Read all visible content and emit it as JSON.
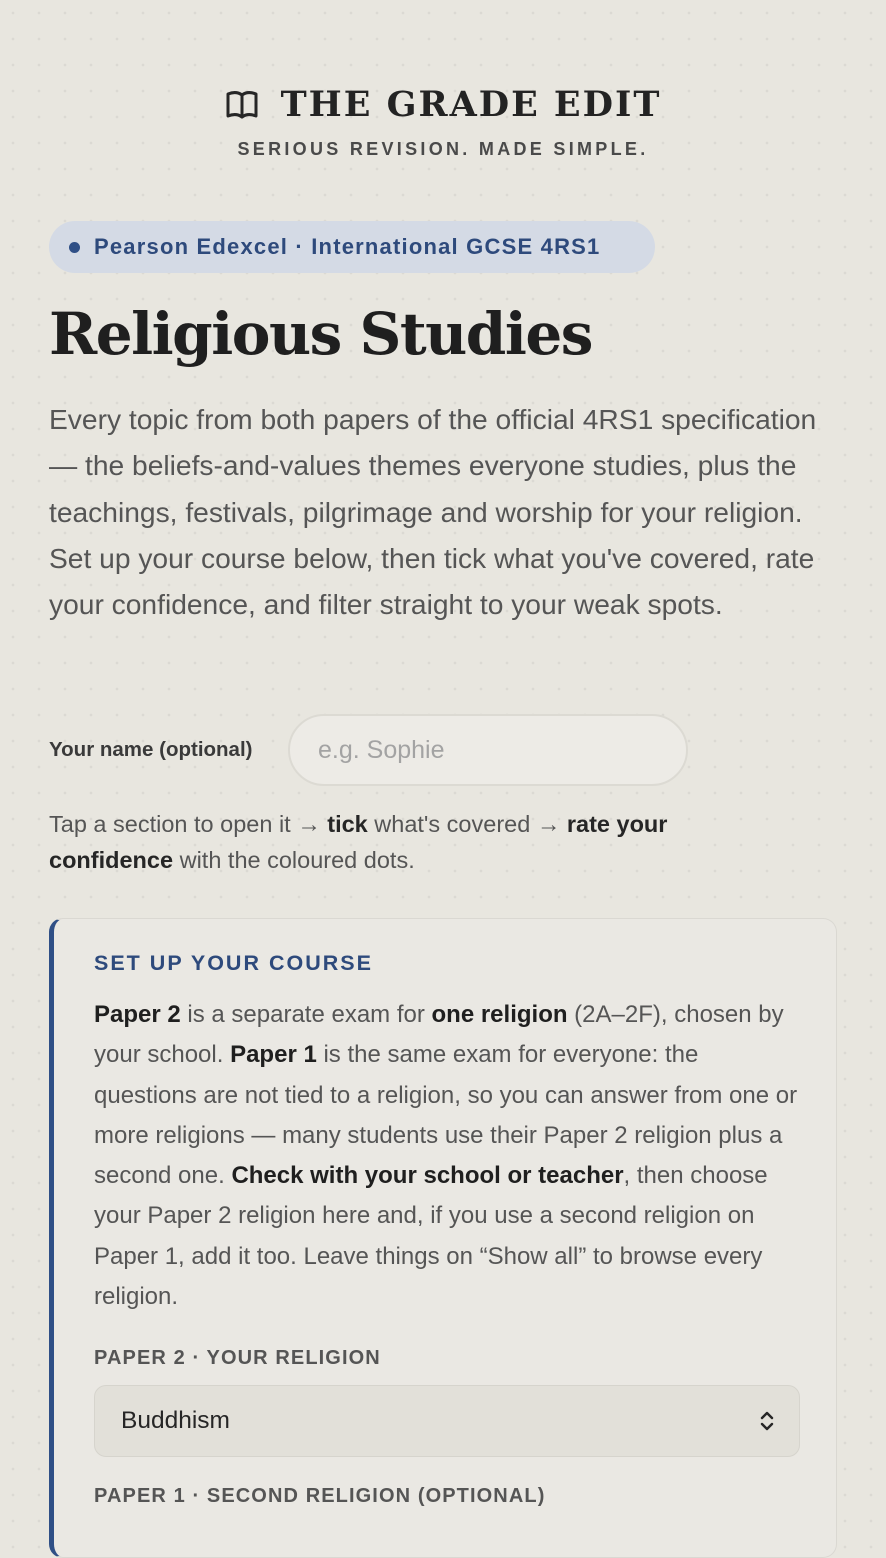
{
  "brand": {
    "title": "THE GRADE EDIT",
    "tagline": "SERIOUS REVISION. MADE SIMPLE.",
    "icon": "open-book-icon"
  },
  "badge": {
    "text": "Pearson Edexcel · International GCSE 4RS1",
    "accent": "#2f4f86"
  },
  "page": {
    "title": "Religious Studies",
    "intro": "Every topic from both papers of the official 4RS1 specification — the beliefs-and-values themes everyone studies, plus the teachings, festivals, pilgrimage and worship for your religion. Set up your course below, then tick what you've covered, rate your confidence, and filter straight to your weak spots."
  },
  "name_field": {
    "label": "Your name (optional)",
    "placeholder": "e.g. Sophie",
    "value": ""
  },
  "hint": {
    "part1": "Tap a section to open it → ",
    "bold1": "tick",
    "part2": " what's covered → ",
    "bold2": "rate your confidence",
    "part3": " with the coloured dots."
  },
  "setup": {
    "heading": "SET UP YOUR COURSE",
    "body": {
      "b1": "Paper 2",
      "t1": " is a separate exam for ",
      "b2": "one religion",
      "t2": " (2A–2F), chosen by your school. ",
      "b3": "Paper 1",
      "t3": " is the same exam for everyone: the questions are not tied to a religion, so you can answer from one or more religions — many students use their Paper 2 religion plus a second one. ",
      "b4": "Check with your school or teacher",
      "t4": ", then choose your Paper 2 religion here and, if you use a second religion on Paper 1, add it too. Leave things on “Show all” to browse every religion."
    },
    "paper2_label": "PAPER 2 · YOUR RELIGION",
    "paper2_value": "Buddhism",
    "paper1_label": "PAPER 1 · SECOND RELIGION (OPTIONAL)"
  }
}
